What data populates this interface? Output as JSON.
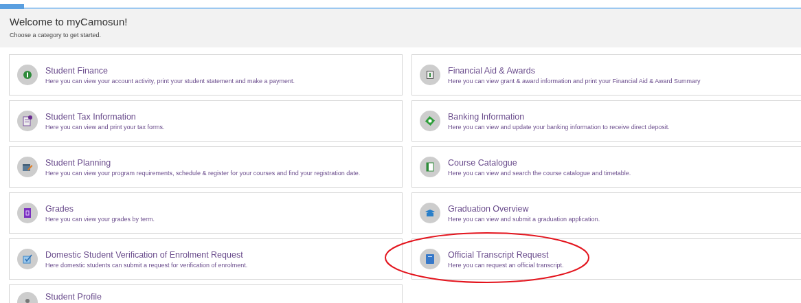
{
  "header": {
    "title": "Welcome to myCamosun!",
    "subtitle": "Choose a category to get started."
  },
  "categories": [
    {
      "title": "Student Finance",
      "description": "Here you can view your account activity, print your student statement and make a payment.",
      "highlighted": false
    },
    {
      "title": "Financial Aid & Awards",
      "description": "Here you can view grant & award information and print your Financial Aid & Award Summary",
      "highlighted": false
    },
    {
      "title": "Student Tax Information",
      "description": "Here you can view and print your tax forms.",
      "highlighted": false
    },
    {
      "title": "Banking Information",
      "description": "Here you can view and update your banking information to receive direct deposit.",
      "highlighted": false
    },
    {
      "title": "Student Planning",
      "description": "Here you can view your program requirements, schedule & register for your courses and find your registration date.",
      "highlighted": false
    },
    {
      "title": "Course Catalogue",
      "description": "Here you can view and search the course catalogue and timetable.",
      "highlighted": false
    },
    {
      "title": "Grades",
      "description": "Here you can view your grades by term.",
      "highlighted": false
    },
    {
      "title": "Graduation Overview",
      "description": "Here you can view and submit a graduation application.",
      "highlighted": false
    },
    {
      "title": "Domestic Student Verification of Enrolment Request",
      "description": "Here domestic students can submit a request for verification of enrolment.",
      "highlighted": false
    },
    {
      "title": "Official Transcript Request",
      "description": "Here you can request an official transcript.",
      "highlighted": true
    },
    {
      "title": "Student Profile",
      "highlighted": false
    }
  ]
}
